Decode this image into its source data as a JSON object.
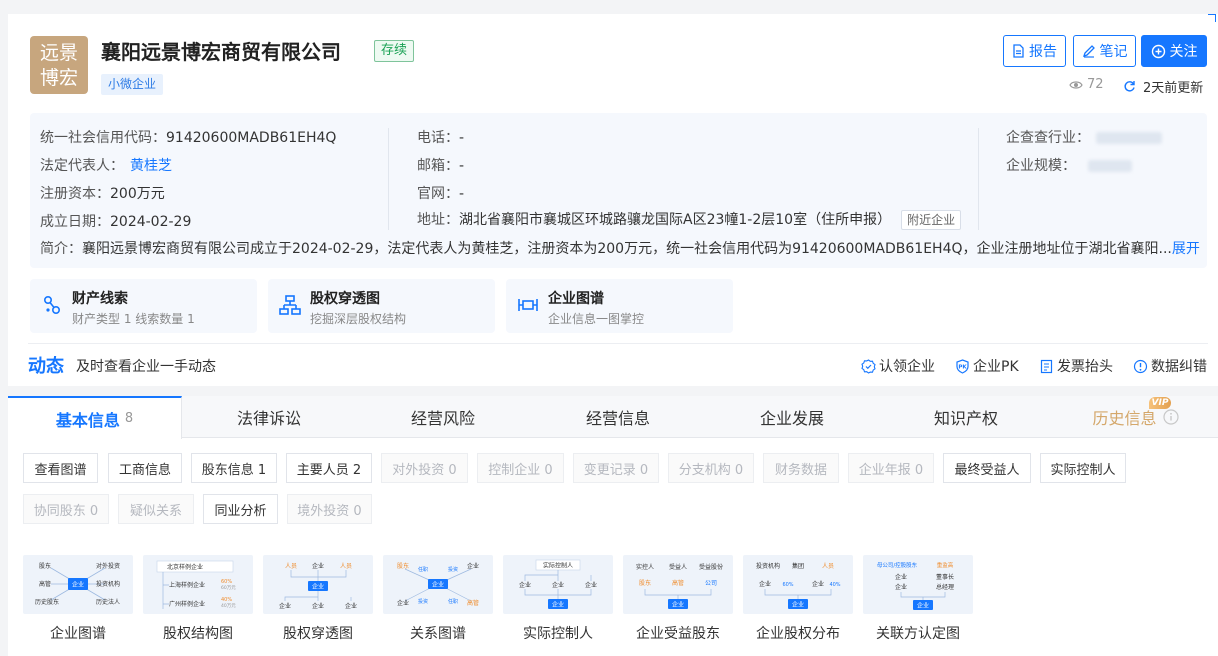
{
  "company": {
    "logo_line1": "远景",
    "logo_line2": "博宏",
    "name": "襄阳远景博宏商贸有限公司",
    "status": "存续",
    "scale_tag": "小微企业"
  },
  "actions": {
    "report": "报告",
    "notes": "笔记",
    "follow": "关注",
    "views": "72",
    "updated": "2天前更新"
  },
  "info": {
    "credit_code_label": "统一社会信用代码：",
    "credit_code": "91420600MADB61EH4Q",
    "legal_rep_label": "法定代表人：",
    "legal_rep": "黄桂芝",
    "capital_label": "注册资本：",
    "capital": "200万元",
    "founded_label": "成立日期：",
    "founded": "2024-02-29",
    "phone_label": "电话：",
    "phone": "-",
    "email_label": "邮箱：",
    "email": "-",
    "website_label": "官网：",
    "website": "-",
    "address_label": "地址：",
    "address": "湖北省襄阳市襄城区环城路骧龙国际A区23幢1-2层10室（住所申报）",
    "nearby": "附近企业",
    "industry_label": "企查查行业：",
    "size_label": "企业规模：",
    "intro_label": "简介：",
    "intro": "襄阳远景博宏商贸有限公司成立于2024-02-29，法定代表人为黄桂芝，注册资本为200万元，统一社会信用代码为91420600MADB61EH4Q，企业注册地址位于湖北省襄阳...",
    "expand": "展开"
  },
  "features": [
    {
      "title": "财产线索",
      "sub": "财产类型 1   线索数量 1",
      "icon": "clue-icon"
    },
    {
      "title": "股权穿透图",
      "sub": "挖掘深层股权结构",
      "icon": "equity-tree-icon"
    },
    {
      "title": "企业图谱",
      "sub": "企业信息一图掌控",
      "icon": "graph-icon"
    }
  ],
  "dynamics": {
    "title": "动态",
    "subtitle": "及时查看企业一手动态",
    "links": [
      "认领企业",
      "企业PK",
      "发票抬头",
      "数据纠错"
    ]
  },
  "tabs": [
    {
      "label": "基本信息",
      "count": "8"
    },
    {
      "label": "法律诉讼"
    },
    {
      "label": "经营风险"
    },
    {
      "label": "经营信息"
    },
    {
      "label": "企业发展"
    },
    {
      "label": "知识产权"
    },
    {
      "label": "历史信息",
      "badge": "VIP"
    }
  ],
  "chips_row1": [
    {
      "label": "查看图谱",
      "disabled": false
    },
    {
      "label": "工商信息",
      "disabled": false
    },
    {
      "label": "股东信息 1",
      "disabled": false
    },
    {
      "label": "主要人员 2",
      "disabled": false
    },
    {
      "label": "对外投资 0",
      "disabled": true
    },
    {
      "label": "控制企业 0",
      "disabled": true
    },
    {
      "label": "变更记录 0",
      "disabled": true
    },
    {
      "label": "分支机构 0",
      "disabled": true
    },
    {
      "label": "财务数据",
      "disabled": true
    },
    {
      "label": "企业年报 0",
      "disabled": true
    },
    {
      "label": "最终受益人",
      "disabled": false
    },
    {
      "label": "实际控制人",
      "disabled": false
    }
  ],
  "chips_row2": [
    {
      "label": "协同股东 0",
      "disabled": true
    },
    {
      "label": "疑似关系",
      "disabled": true
    },
    {
      "label": "同业分析",
      "disabled": false
    },
    {
      "label": "境外投资 0",
      "disabled": true
    }
  ],
  "graphs": [
    {
      "label": "企业图谱"
    },
    {
      "label": "股权结构图"
    },
    {
      "label": "股权穿透图"
    },
    {
      "label": "关系图谱"
    },
    {
      "label": "实际控制人"
    },
    {
      "label": "企业受益股东"
    },
    {
      "label": "企业股权分布"
    },
    {
      "label": "关联方认定图"
    }
  ],
  "thumb_text": {
    "t1": [
      "股东",
      "对外投资",
      "高管",
      "投资机构",
      "历史股东",
      "历史法人",
      "企业"
    ],
    "t2": [
      "北京样例企业",
      "上海样例企业",
      "60%",
      "60万元",
      "广州样例企业",
      "40%",
      "40万元"
    ],
    "t3": [
      "人员",
      "企业",
      "人员",
      "企业",
      "企业",
      "企业",
      "企业"
    ],
    "t4": [
      "股东",
      "任职",
      "投资",
      "企业",
      "企业",
      "投资",
      "任职",
      "高管",
      "企业"
    ],
    "t5": [
      "实际控制人",
      "企业",
      "企业",
      "企业",
      "企业"
    ],
    "t6": [
      "实控人",
      "受益人",
      "受益股份",
      "股东",
      "高管",
      "公司",
      "企业"
    ],
    "t7": [
      "投资机构",
      "集团",
      "人员",
      "企业",
      "60%",
      "企业",
      "40%",
      "企业"
    ],
    "t8": [
      "母公司/控股股东",
      "重监高",
      "企业",
      "董事长",
      "企业",
      "总经理",
      "企业"
    ]
  },
  "colors": {
    "accent": "#1677ff",
    "status_green": "#1aa154",
    "logo_bg": "#c7a67e",
    "vip_gold": "#d4a76a"
  }
}
